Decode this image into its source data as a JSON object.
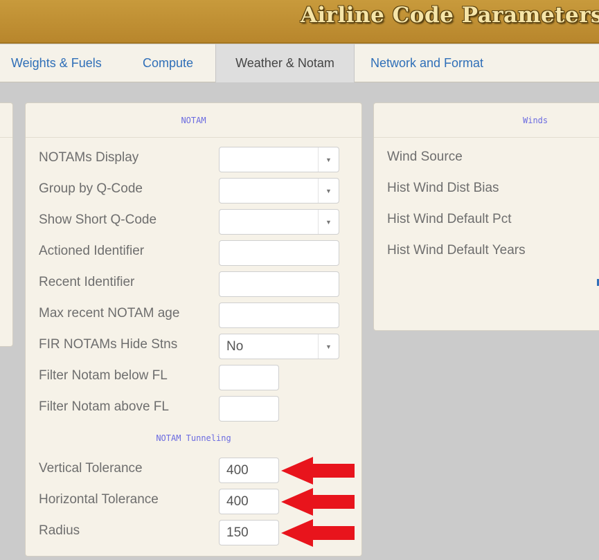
{
  "header": {
    "title": "Airline Code Parameters"
  },
  "tabs": [
    {
      "label": "Weights & Fuels"
    },
    {
      "label": "Compute"
    },
    {
      "label": "Weather & Notam"
    },
    {
      "label": "Network and Format"
    }
  ],
  "notam": {
    "title": "NOTAM",
    "fields": [
      {
        "label": "NOTAMs Display",
        "value": ""
      },
      {
        "label": "Group by Q-Code",
        "value": ""
      },
      {
        "label": "Show Short Q-Code",
        "value": ""
      },
      {
        "label": "Actioned Identifier",
        "value": ""
      },
      {
        "label": "Recent Identifier",
        "value": ""
      },
      {
        "label": "Max recent NOTAM age",
        "value": ""
      },
      {
        "label": "FIR NOTAMs Hide Stns",
        "value": "No"
      },
      {
        "label": "Filter Notam below FL",
        "value": ""
      },
      {
        "label": "Filter Notam above FL",
        "value": ""
      }
    ],
    "tunneling_title": "NOTAM Tunneling",
    "tunneling": [
      {
        "label": "Vertical Tolerance",
        "value": "400"
      },
      {
        "label": "Horizontal Tolerance",
        "value": "400"
      },
      {
        "label": "Radius",
        "value": "150"
      }
    ]
  },
  "winds": {
    "title": "Winds",
    "fields": [
      {
        "label": "Wind Source"
      },
      {
        "label": "Hist Wind Dist Bias"
      },
      {
        "label": "Hist Wind Default Pct"
      },
      {
        "label": "Hist Wind Default Years"
      }
    ]
  },
  "colors": {
    "annotation_arrow": "#e8141c",
    "header": "#c0902f",
    "link": "#2f6fb8"
  }
}
